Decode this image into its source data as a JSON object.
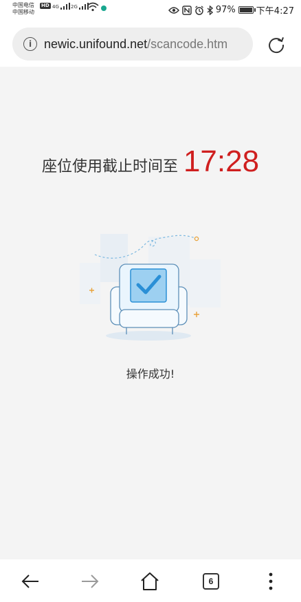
{
  "status_bar": {
    "carrier_line1": "中国电信",
    "carrier_line2": "中国移动",
    "hd": "HD",
    "signal1": "4G",
    "signal2": "2G",
    "battery": "97%",
    "time": "下午4:27"
  },
  "browser": {
    "url_host": "newic.unifound.net",
    "url_path": "/scancode.htm"
  },
  "page": {
    "deadline_label": "座位使用截止时间至",
    "deadline_time": "17:28",
    "success_message": "操作成功!"
  },
  "nav": {
    "tab_count": "6"
  },
  "colors": {
    "accent_red": "#cf1f1f",
    "check_blue": "#2a8fd6",
    "background": "#f4f4f4"
  }
}
